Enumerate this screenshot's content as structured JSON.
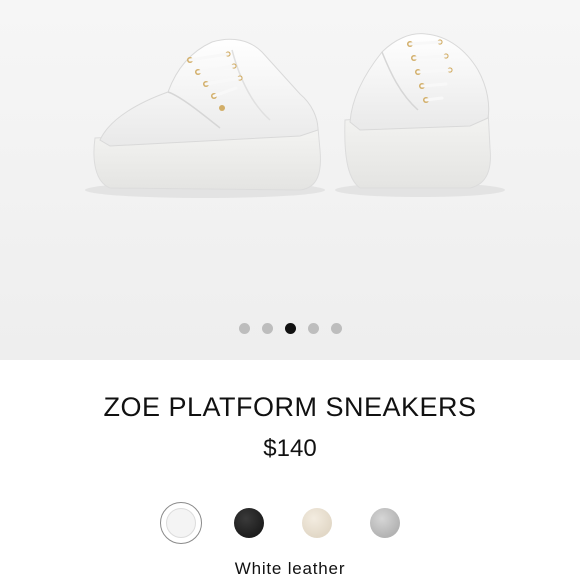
{
  "product": {
    "title": "ZOE PLATFORM SNEAKERS",
    "price": "$140",
    "image_alt": "White leather platform sneakers pair"
  },
  "gallery": {
    "total_images": 5,
    "active_index": 2
  },
  "colors": {
    "selected_label": "White leather",
    "options": [
      {
        "icon": "white-swatch",
        "hex": "#f4f4f4",
        "selected": true
      },
      {
        "icon": "black-swatch",
        "hex": "#1d1d1d",
        "selected": false
      },
      {
        "icon": "beige-swatch",
        "hex": "#e2d8c7",
        "selected": false
      },
      {
        "icon": "grey-swatch",
        "hex": "#b3b3b3",
        "selected": false
      }
    ]
  },
  "theme": {
    "background": "#ffffff",
    "gallery_background": "#f1f1f1",
    "text": "#111111",
    "dot_inactive": "#bdbdbd",
    "dot_active": "#111111"
  }
}
